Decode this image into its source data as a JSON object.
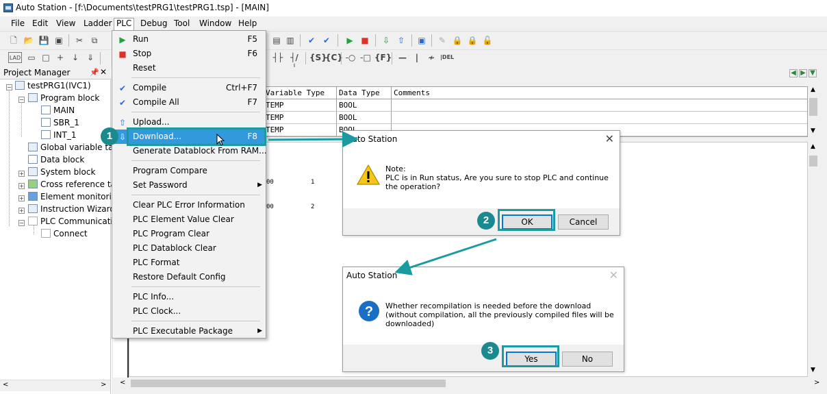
{
  "window": {
    "title": "Auto Station - [f:\\Documents\\testPRG1\\testPRG1.tsp] - [MAIN]"
  },
  "menubar": [
    "File",
    "Edit",
    "View",
    "Ladder",
    "PLC",
    "Debug",
    "Tool",
    "Window",
    "Help"
  ],
  "project_manager": {
    "title": "Project Manager",
    "tree": [
      {
        "label": "testPRG1(IVC1)"
      },
      {
        "label": "Program block"
      },
      {
        "label": "MAIN"
      },
      {
        "label": "SBR_1"
      },
      {
        "label": "INT_1"
      },
      {
        "label": "Global variable tab"
      },
      {
        "label": "Data block"
      },
      {
        "label": "System block"
      },
      {
        "label": "Cross reference tal"
      },
      {
        "label": "Element monitorin"
      },
      {
        "label": "Instruction Wizard"
      },
      {
        "label": "PLC Communicati"
      },
      {
        "label": "Connect"
      }
    ]
  },
  "variable_table": {
    "columns": [
      "Variable Type",
      "Data Type",
      "Comments"
    ],
    "rows": [
      [
        "TEMP",
        "BOOL",
        ""
      ],
      [
        "TEMP",
        "BOOL",
        ""
      ],
      [
        "TEMP",
        "BOOL",
        ""
      ]
    ]
  },
  "ladder": {
    "fragments": [
      "00",
      "1",
      "00",
      "2"
    ]
  },
  "plc_menu": {
    "items": [
      {
        "label": "Run",
        "shortcut": "F5",
        "icon": "run-icon"
      },
      {
        "label": "Stop",
        "shortcut": "F6",
        "icon": "stop-icon"
      },
      {
        "label": "Reset",
        "shortcut": ""
      },
      {
        "label": "Compile",
        "shortcut": "Ctrl+F7",
        "icon": "check-icon"
      },
      {
        "label": "Compile All",
        "shortcut": "F7",
        "icon": "double-check-icon"
      },
      {
        "label": "Upload...",
        "shortcut": "",
        "icon": "upload-icon"
      },
      {
        "label": "Download...",
        "shortcut": "F8",
        "icon": "download-icon"
      },
      {
        "label": "Generate Datablock From RAM...",
        "shortcut": ""
      },
      {
        "label": "Program Compare",
        "shortcut": ""
      },
      {
        "label": "Set Password",
        "shortcut": "",
        "submenu": true
      },
      {
        "label": "Clear PLC Error Information",
        "shortcut": ""
      },
      {
        "label": "PLC Element Value Clear",
        "shortcut": ""
      },
      {
        "label": "PLC Program Clear",
        "shortcut": ""
      },
      {
        "label": "PLC Datablock Clear",
        "shortcut": ""
      },
      {
        "label": "PLC Format",
        "shortcut": ""
      },
      {
        "label": "Restore Default Config",
        "shortcut": ""
      },
      {
        "label": "PLC Info...",
        "shortcut": ""
      },
      {
        "label": "PLC Clock...",
        "shortcut": ""
      },
      {
        "label": "PLC Executable Package",
        "shortcut": "",
        "submenu": true
      }
    ]
  },
  "toolbar2_labels": [
    "LAD",
    "S",
    "C",
    "F",
    "DEL"
  ],
  "steps": [
    "1",
    "2",
    "3"
  ],
  "dialog_stop": {
    "title": "Auto Station",
    "message": "Note:\n  PLC is in Run status, Are you sure to stop PLC and continue\nthe operation?",
    "ok": "OK",
    "cancel": "Cancel"
  },
  "dialog_compile": {
    "title": "Auto Station",
    "message": "Whether recompilation is needed before the download\n (without compilation, all the previously compiled files will be\ndownloaded)",
    "yes": "Yes",
    "no": "No"
  },
  "colors": {
    "accent": "#1b9aa0",
    "menu_highlight": "#3399dd"
  }
}
